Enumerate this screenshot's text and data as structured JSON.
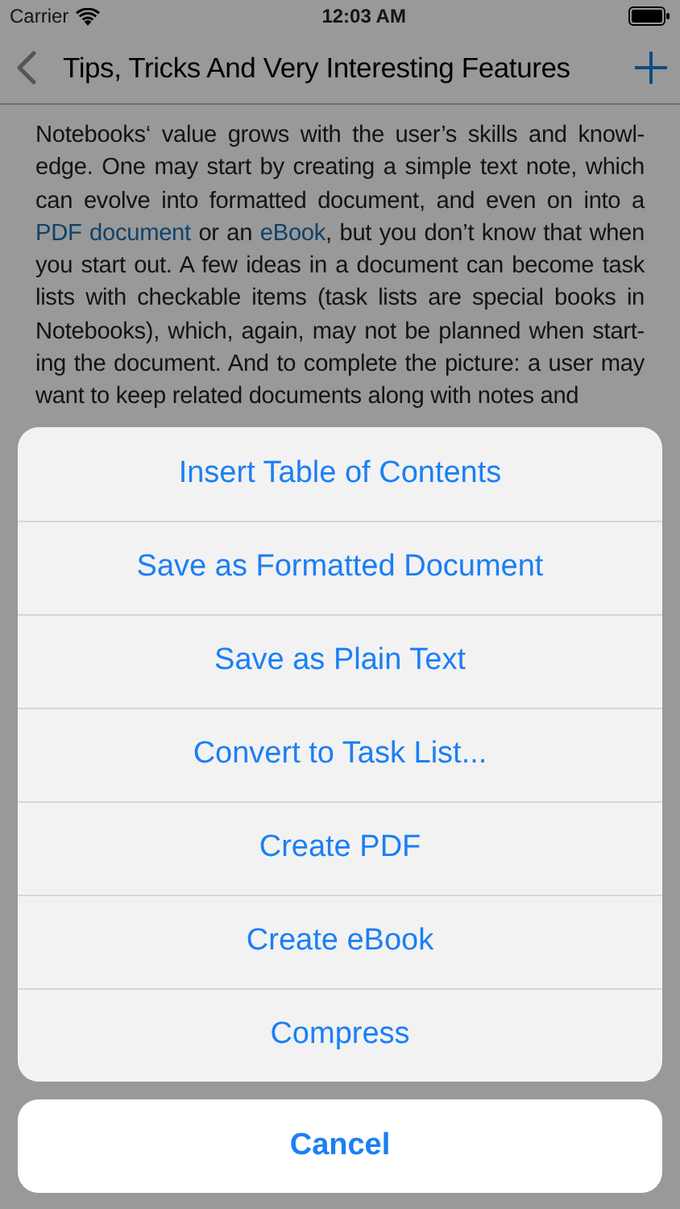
{
  "status_bar": {
    "carrier": "Carrier",
    "time": "12:03 AM"
  },
  "nav_bar": {
    "title": "Tips, Tricks And Very Interesting Features"
  },
  "paragraph": [
    {
      "kind": "text",
      "text": "Notebooks‘ value grows with the user’s skills and knowl-edge. One may start by creating a simple text note, which can evolve into formatted document, and even on into a "
    },
    {
      "kind": "link",
      "text": "PDF document"
    },
    {
      "kind": "text",
      "text": " or an "
    },
    {
      "kind": "link",
      "text": "eBook"
    },
    {
      "kind": "text",
      "text": ", but you don’t know that when you start out. A few ideas in a document can become task lists with checkable items (task lists are special books in Notebooks), which, again, may not be planned when start-ing the document. And to complete the picture: a user may want to keep related documents along with notes and"
    }
  ],
  "action_sheet": {
    "actions": [
      "Insert Table of Contents",
      "Save as Formatted Document",
      "Save as Plain Text",
      "Convert to Task List...",
      "Create PDF",
      "Create eBook",
      "Compress"
    ],
    "cancel": "Cancel"
  }
}
